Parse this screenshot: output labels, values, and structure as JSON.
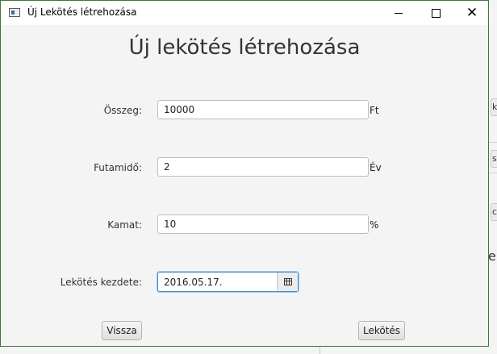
{
  "window": {
    "title": "Új Lekötés létrehozása",
    "icon": "app-window-icon",
    "controls": {
      "minimize": "minimize-icon",
      "maximize": "maximize-icon",
      "close": "close-icon"
    }
  },
  "form": {
    "heading": "Új lekötés létrehozása",
    "amount": {
      "label": "Összeg:",
      "value": "10000",
      "unit": "Ft"
    },
    "term": {
      "label": "Futamidő:",
      "value": "2",
      "unit": "Év"
    },
    "interest": {
      "label": "Kamat:",
      "value": "10",
      "unit": "%"
    },
    "start_date": {
      "label": "Lekötés kezdete:",
      "value": "2016.05.17.",
      "picker_icon": "calendar-icon"
    }
  },
  "buttons": {
    "back": "Vissza",
    "submit": "Lekötés"
  },
  "background_window": {
    "button_fragments": [
      "k",
      "s",
      "ci"
    ],
    "text_fragment": "e"
  },
  "colors": {
    "window_border": "#3a7a3a",
    "focus_border": "#3c92d6",
    "background": "#f4f4f4"
  }
}
